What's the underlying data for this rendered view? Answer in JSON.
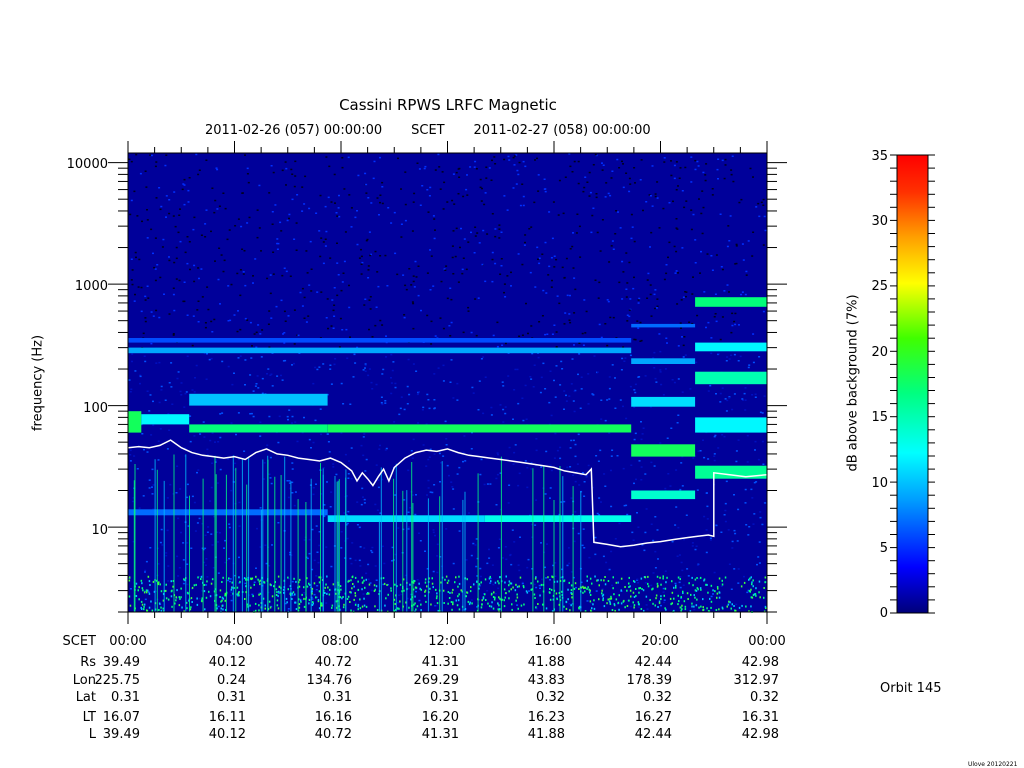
{
  "header": {
    "title": "Cassini RPWS LRFC Magnetic",
    "start_label": "2011-02-26 (057) 00:00:00",
    "scet_label": "SCET",
    "end_label": "2011-02-27 (058) 00:00:00"
  },
  "colorbar": {
    "label": "dB above background (7%)",
    "ticks": [
      "0",
      "5",
      "10",
      "15",
      "20",
      "25",
      "30",
      "35"
    ],
    "range": [
      0,
      35
    ],
    "colors": [
      "#00007a",
      "#0000ff",
      "#00a0ff",
      "#00ffff",
      "#00ff80",
      "#40ff00",
      "#ffff00",
      "#ffa000",
      "#ff3000",
      "#ff0000"
    ]
  },
  "ephemeris": {
    "rows": [
      {
        "label": "SCET",
        "values": [
          "00:00",
          "04:00",
          "08:00",
          "12:00",
          "16:00",
          "20:00",
          "00:00"
        ]
      },
      {
        "label": "Rs",
        "values": [
          "39.49",
          "40.12",
          "40.72",
          "41.31",
          "41.88",
          "42.44",
          "42.98"
        ]
      },
      {
        "label": "Lon",
        "values": [
          "225.75",
          "0.24",
          "134.76",
          "269.29",
          "43.83",
          "178.39",
          "312.97"
        ]
      },
      {
        "label": "Lat",
        "values": [
          "0.31",
          "0.31",
          "0.31",
          "0.31",
          "0.32",
          "0.32",
          "0.32"
        ]
      },
      {
        "label": "LT",
        "values": [
          "16.07",
          "16.11",
          "16.16",
          "16.20",
          "16.23",
          "16.27",
          "16.31"
        ]
      },
      {
        "label": "L",
        "values": [
          "39.49",
          "40.12",
          "40.72",
          "41.31",
          "41.88",
          "42.44",
          "42.98"
        ]
      }
    ]
  },
  "orbit": "Orbit 145",
  "credit": "Ulove 20120221",
  "chart_data": {
    "type": "heatmap",
    "title": "Cassini RPWS LRFC Magnetic",
    "ylabel": "frequency (Hz)",
    "xlabel": "SCET",
    "y_scale": "log",
    "ylim": [
      2,
      12000
    ],
    "xlim_hours": [
      0,
      24
    ],
    "y_ticks": [
      "10",
      "100",
      "1000",
      "10000"
    ],
    "x_ticks": [
      "00:00",
      "04:00",
      "08:00",
      "12:00",
      "16:00",
      "20:00",
      "00:00"
    ],
    "bands": [
      {
        "t0": 0.0,
        "t1": 0.5,
        "f0": 60,
        "f1": 90,
        "db": 18
      },
      {
        "t0": 0.5,
        "t1": 2.3,
        "f0": 70,
        "f1": 85,
        "db": 12
      },
      {
        "t0": 2.3,
        "t1": 7.5,
        "f0": 60,
        "f1": 70,
        "db": 17
      },
      {
        "t0": 2.3,
        "t1": 7.5,
        "f0": 100,
        "f1": 125,
        "db": 10
      },
      {
        "t0": 7.5,
        "t1": 18.9,
        "f0": 60,
        "f1": 70,
        "db": 18
      },
      {
        "t0": 7.5,
        "t1": 13.4,
        "f0": 11,
        "f1": 12.5,
        "db": 11
      },
      {
        "t0": 13.4,
        "t1": 18.9,
        "f0": 11,
        "f1": 12.5,
        "db": 13
      },
      {
        "t0": 0.0,
        "t1": 7.5,
        "f0": 12.5,
        "f1": 14,
        "db": 7
      },
      {
        "t0": 0.0,
        "t1": 18.9,
        "f0": 270,
        "f1": 300,
        "db": 9
      },
      {
        "t0": 0.0,
        "t1": 18.9,
        "f0": 330,
        "f1": 360,
        "db": 6
      },
      {
        "t0": 18.9,
        "t1": 21.3,
        "f0": 17,
        "f1": 20,
        "db": 14
      },
      {
        "t0": 18.9,
        "t1": 21.3,
        "f0": 38,
        "f1": 48,
        "db": 18
      },
      {
        "t0": 18.9,
        "t1": 21.3,
        "f0": 98,
        "f1": 118,
        "db": 11
      },
      {
        "t0": 18.9,
        "t1": 21.3,
        "f0": 220,
        "f1": 245,
        "db": 9
      },
      {
        "t0": 18.9,
        "t1": 21.3,
        "f0": 440,
        "f1": 470,
        "db": 7
      },
      {
        "t0": 21.3,
        "t1": 24.0,
        "f0": 25,
        "f1": 32,
        "db": 16
      },
      {
        "t0": 21.3,
        "t1": 24.0,
        "f0": 60,
        "f1": 80,
        "db": 12
      },
      {
        "t0": 21.3,
        "t1": 24.0,
        "f0": 150,
        "f1": 190,
        "db": 15
      },
      {
        "t0": 21.3,
        "t1": 24.0,
        "f0": 280,
        "f1": 330,
        "db": 12
      },
      {
        "t0": 21.3,
        "t1": 24.0,
        "f0": 650,
        "f1": 780,
        "db": 17
      }
    ],
    "trace": {
      "color": "#ffffff",
      "points": [
        [
          0.0,
          45
        ],
        [
          0.4,
          46
        ],
        [
          0.8,
          45
        ],
        [
          1.2,
          47
        ],
        [
          1.6,
          52
        ],
        [
          2.0,
          45
        ],
        [
          2.4,
          41
        ],
        [
          2.8,
          39
        ],
        [
          3.2,
          38
        ],
        [
          3.6,
          37
        ],
        [
          4.0,
          38
        ],
        [
          4.4,
          36
        ],
        [
          4.8,
          41
        ],
        [
          5.2,
          44
        ],
        [
          5.6,
          40
        ],
        [
          6.0,
          39
        ],
        [
          6.4,
          37
        ],
        [
          6.8,
          36
        ],
        [
          7.2,
          35
        ],
        [
          7.6,
          37
        ],
        [
          8.0,
          34
        ],
        [
          8.4,
          29
        ],
        [
          8.6,
          24
        ],
        [
          8.8,
          28
        ],
        [
          9.0,
          25
        ],
        [
          9.2,
          22
        ],
        [
          9.4,
          26
        ],
        [
          9.6,
          30
        ],
        [
          9.8,
          24
        ],
        [
          10.0,
          31
        ],
        [
          10.4,
          37
        ],
        [
          10.8,
          41
        ],
        [
          11.2,
          43
        ],
        [
          11.6,
          42
        ],
        [
          12.0,
          44
        ],
        [
          12.4,
          41
        ],
        [
          12.8,
          39
        ],
        [
          13.2,
          38
        ],
        [
          13.6,
          37
        ],
        [
          14.0,
          36
        ],
        [
          14.4,
          35
        ],
        [
          14.8,
          34
        ],
        [
          15.2,
          33
        ],
        [
          15.6,
          32
        ],
        [
          16.0,
          31
        ],
        [
          16.4,
          29
        ],
        [
          16.8,
          28
        ],
        [
          17.2,
          27
        ],
        [
          17.4,
          30
        ],
        [
          17.5,
          7.5
        ],
        [
          18.0,
          7.2
        ],
        [
          18.5,
          6.9
        ],
        [
          19.0,
          7.1
        ],
        [
          19.5,
          7.4
        ],
        [
          20.0,
          7.6
        ],
        [
          20.5,
          7.9
        ],
        [
          21.0,
          8.2
        ],
        [
          21.4,
          8.4
        ],
        [
          21.8,
          8.6
        ],
        [
          22.0,
          8.4
        ],
        [
          22.0,
          28
        ],
        [
          22.6,
          27
        ],
        [
          23.2,
          26
        ],
        [
          24.0,
          27
        ]
      ]
    }
  }
}
